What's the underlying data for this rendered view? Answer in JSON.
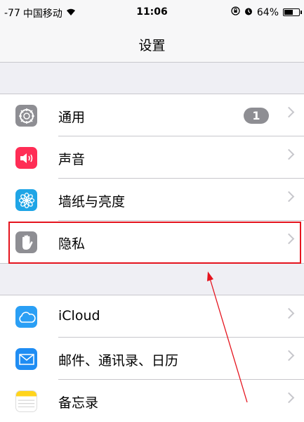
{
  "statusbar": {
    "signal": "-77",
    "carrier": "中国移动",
    "time": "11:06",
    "battery_percent": "64%",
    "battery_level": 0.64,
    "icons": [
      "wifi-icon",
      "orientation-lock-icon",
      "alarm-icon",
      "battery-icon"
    ]
  },
  "navbar": {
    "title": "设置"
  },
  "groups": [
    {
      "items": [
        {
          "label": "通用",
          "icon": "gear-icon",
          "icon_color": "#8e8e93",
          "badge": "1"
        },
        {
          "label": "声音",
          "icon": "speaker-icon",
          "icon_color": "#ff2d55"
        },
        {
          "label": "墙纸与亮度",
          "icon": "flower-icon",
          "icon_color": "#1fa5e6"
        },
        {
          "label": "隐私",
          "icon": "hand-icon",
          "icon_color": "#8e8e93"
        }
      ]
    },
    {
      "items": [
        {
          "label": "iCloud",
          "icon": "cloud-icon",
          "icon_color": "#2a9ff5"
        },
        {
          "label": "邮件、通讯录、日历",
          "icon": "mail-icon",
          "icon_color": "#1f8df3"
        },
        {
          "label": "备忘录",
          "icon": "notes-icon",
          "icon_color": "#ffd41c"
        }
      ]
    }
  ],
  "annotation": {
    "highlight_color": "#e5141e",
    "arrow_color": "#e5141e"
  }
}
